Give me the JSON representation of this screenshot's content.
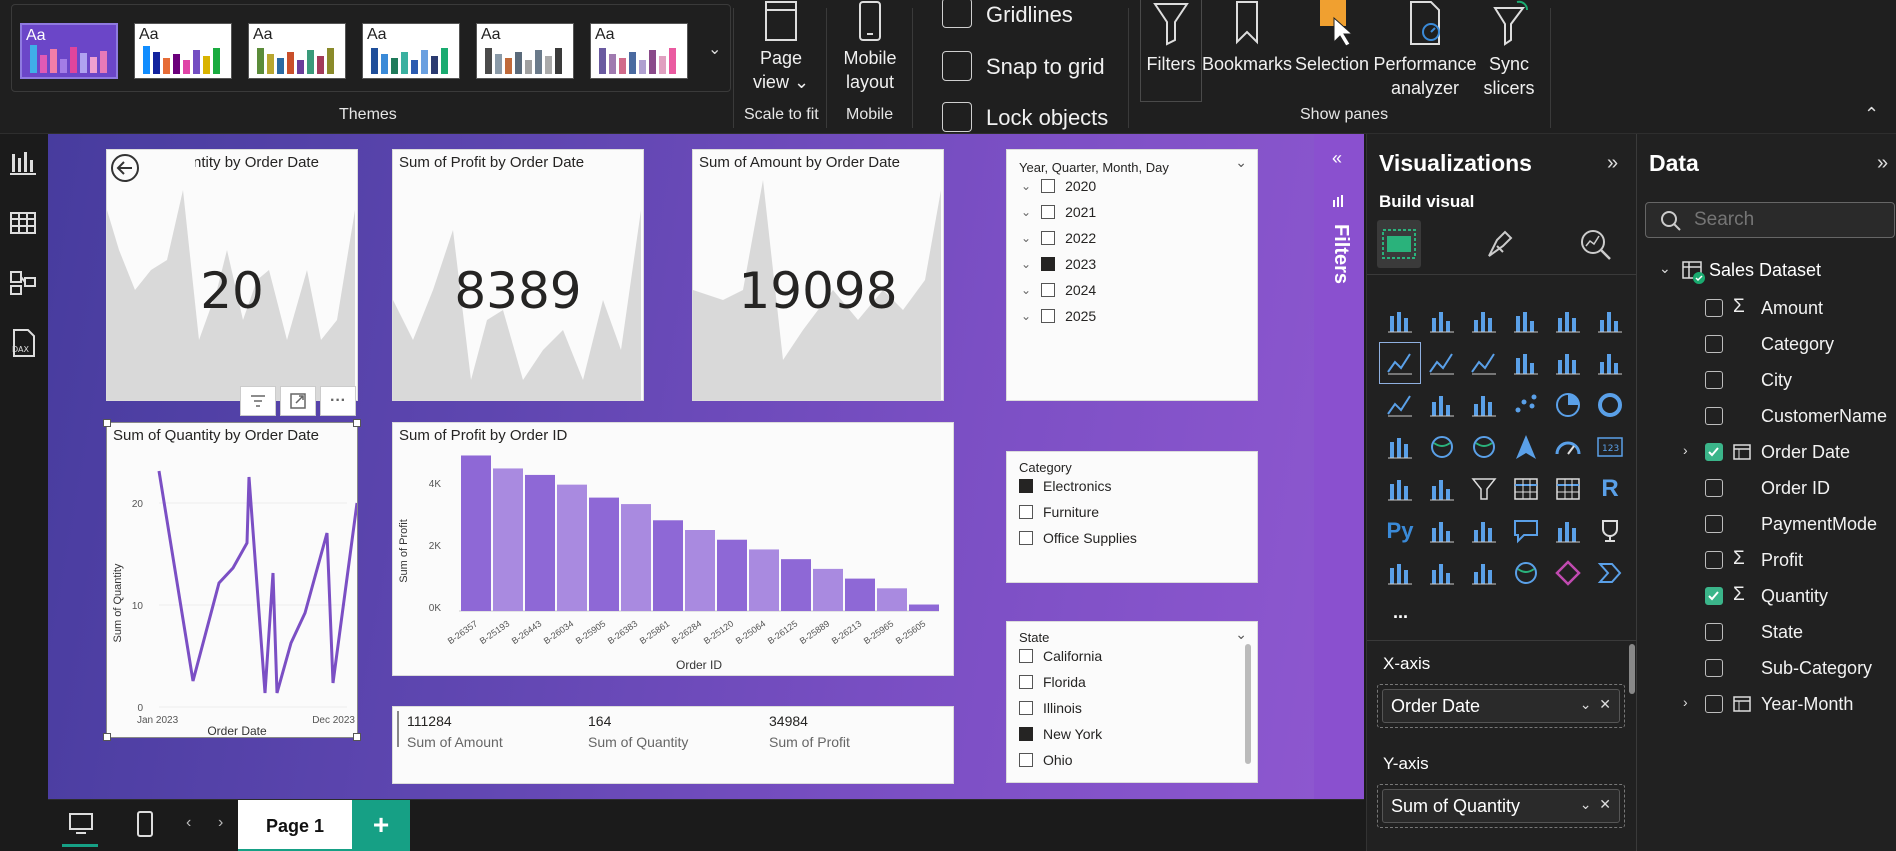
{
  "ribbon": {
    "themes_label": "Themes",
    "theme_aa": "Aa",
    "page_view": {
      "label": "Page",
      "label2": "view",
      "group": "Scale to fit"
    },
    "mobile": {
      "label": "Mobile",
      "label2": "layout",
      "group": "Mobile"
    },
    "options": [
      "Gridlines",
      "Snap to grid",
      "Lock objects"
    ],
    "panes": [
      {
        "label": "Filters",
        "label2": ""
      },
      {
        "label": "Bookmarks",
        "label2": ""
      },
      {
        "label": "Selection",
        "label2": ""
      },
      {
        "label": "Performance",
        "label2": "analyzer"
      },
      {
        "label": "Sync",
        "label2": "slicers"
      }
    ],
    "show_panes_label": "Show panes"
  },
  "cards": {
    "qty_area_title": "Sum of Quantity by Order Date",
    "qty_area_value": "20",
    "profit_area_title": "Sum of Profit by Order Date",
    "profit_area_value": "8389",
    "amount_area_title": "Sum of Amount by Order Date",
    "amount_area_value": "19098",
    "qty_line_title": "Sum of Quantity by Order Date",
    "profit_bar_title": "Sum of Profit by Order ID"
  },
  "line_chart": {
    "ylabel": "Sum of Quantity",
    "xlabel": "Order Date",
    "yticks": [
      "20",
      "10",
      "0"
    ],
    "xstart": "Jan 2023",
    "xend": "Dec 2023"
  },
  "bar_chart": {
    "ylabel": "Sum of Profit",
    "xlabel": "Order ID",
    "yticks": [
      "4K",
      "2K",
      "0K"
    ],
    "xticks": [
      "B-26357",
      "B-25193",
      "B-26443",
      "B-26034",
      "B-25905",
      "B-26383",
      "B-25861",
      "B-26284",
      "B-25120",
      "B-25064",
      "B-26125",
      "B-25889",
      "B-26213",
      "B-25965",
      "B-25605"
    ]
  },
  "chart_data": {
    "type": "bar",
    "categories": [
      "B-26357",
      "B-25193",
      "B-26443",
      "B-26034",
      "B-25905",
      "B-26383",
      "B-25861",
      "B-26284",
      "B-25120",
      "B-25064",
      "B-26125",
      "B-25889",
      "B-26213",
      "B-25965",
      "B-25605"
    ],
    "values": [
      4800,
      4400,
      4200,
      3900,
      3500,
      3300,
      2800,
      2500,
      2200,
      1900,
      1600,
      1300,
      1000,
      700,
      200
    ],
    "xlabel": "Order ID",
    "ylabel": "Sum of Profit",
    "ylim": [
      0,
      5000
    ]
  },
  "date_slicer": {
    "header": "Year, Quarter, Month, Day",
    "years": [
      {
        "label": "2020",
        "checked": false
      },
      {
        "label": "2021",
        "checked": false
      },
      {
        "label": "2022",
        "checked": false
      },
      {
        "label": "2023",
        "checked": true
      },
      {
        "label": "2024",
        "checked": false
      },
      {
        "label": "2025",
        "checked": false
      }
    ]
  },
  "category_slicer": {
    "header": "Category",
    "items": [
      {
        "label": "Electronics",
        "checked": true
      },
      {
        "label": "Furniture",
        "checked": false
      },
      {
        "label": "Office Supplies",
        "checked": false
      }
    ]
  },
  "state_slicer": {
    "header": "State",
    "items": [
      {
        "label": "California",
        "checked": false
      },
      {
        "label": "Florida",
        "checked": false
      },
      {
        "label": "Illinois",
        "checked": false
      },
      {
        "label": "New York",
        "checked": true
      },
      {
        "label": "Ohio",
        "checked": false
      }
    ]
  },
  "totals": [
    {
      "value": "111284",
      "label": "Sum of Amount"
    },
    {
      "value": "164",
      "label": "Sum of Quantity"
    },
    {
      "value": "34984",
      "label": "Sum of Profit"
    }
  ],
  "filters_label": "Filters",
  "statusbar": {
    "page_tab": "Page 1",
    "add": "+"
  },
  "viz_pane": {
    "title": "Visualizations",
    "build_visual": "Build visual",
    "x_axis_label": "X-axis",
    "x_axis_value": "Order Date",
    "y_axis_label": "Y-axis",
    "y_axis_value": "Sum of Quantity",
    "more": "..."
  },
  "data_pane": {
    "title": "Data",
    "search_placeholder": "Search",
    "dataset": "Sales Dataset",
    "fields": [
      {
        "label": "Amount",
        "sigma": true,
        "checked": false,
        "table": false
      },
      {
        "label": "Category",
        "sigma": false,
        "checked": false,
        "table": false
      },
      {
        "label": "City",
        "sigma": false,
        "checked": false,
        "table": false
      },
      {
        "label": "CustomerName",
        "sigma": false,
        "checked": false,
        "table": false
      },
      {
        "label": "Order Date",
        "sigma": false,
        "checked": true,
        "table": true
      },
      {
        "label": "Order ID",
        "sigma": false,
        "checked": false,
        "table": false
      },
      {
        "label": "PaymentMode",
        "sigma": false,
        "checked": false,
        "table": false
      },
      {
        "label": "Profit",
        "sigma": true,
        "checked": false,
        "table": false
      },
      {
        "label": "Quantity",
        "sigma": true,
        "checked": true,
        "table": false
      },
      {
        "label": "State",
        "sigma": false,
        "checked": false,
        "table": false
      },
      {
        "label": "Sub-Category",
        "sigma": false,
        "checked": false,
        "table": false
      },
      {
        "label": "Year-Month",
        "sigma": false,
        "checked": false,
        "table": true
      }
    ]
  }
}
